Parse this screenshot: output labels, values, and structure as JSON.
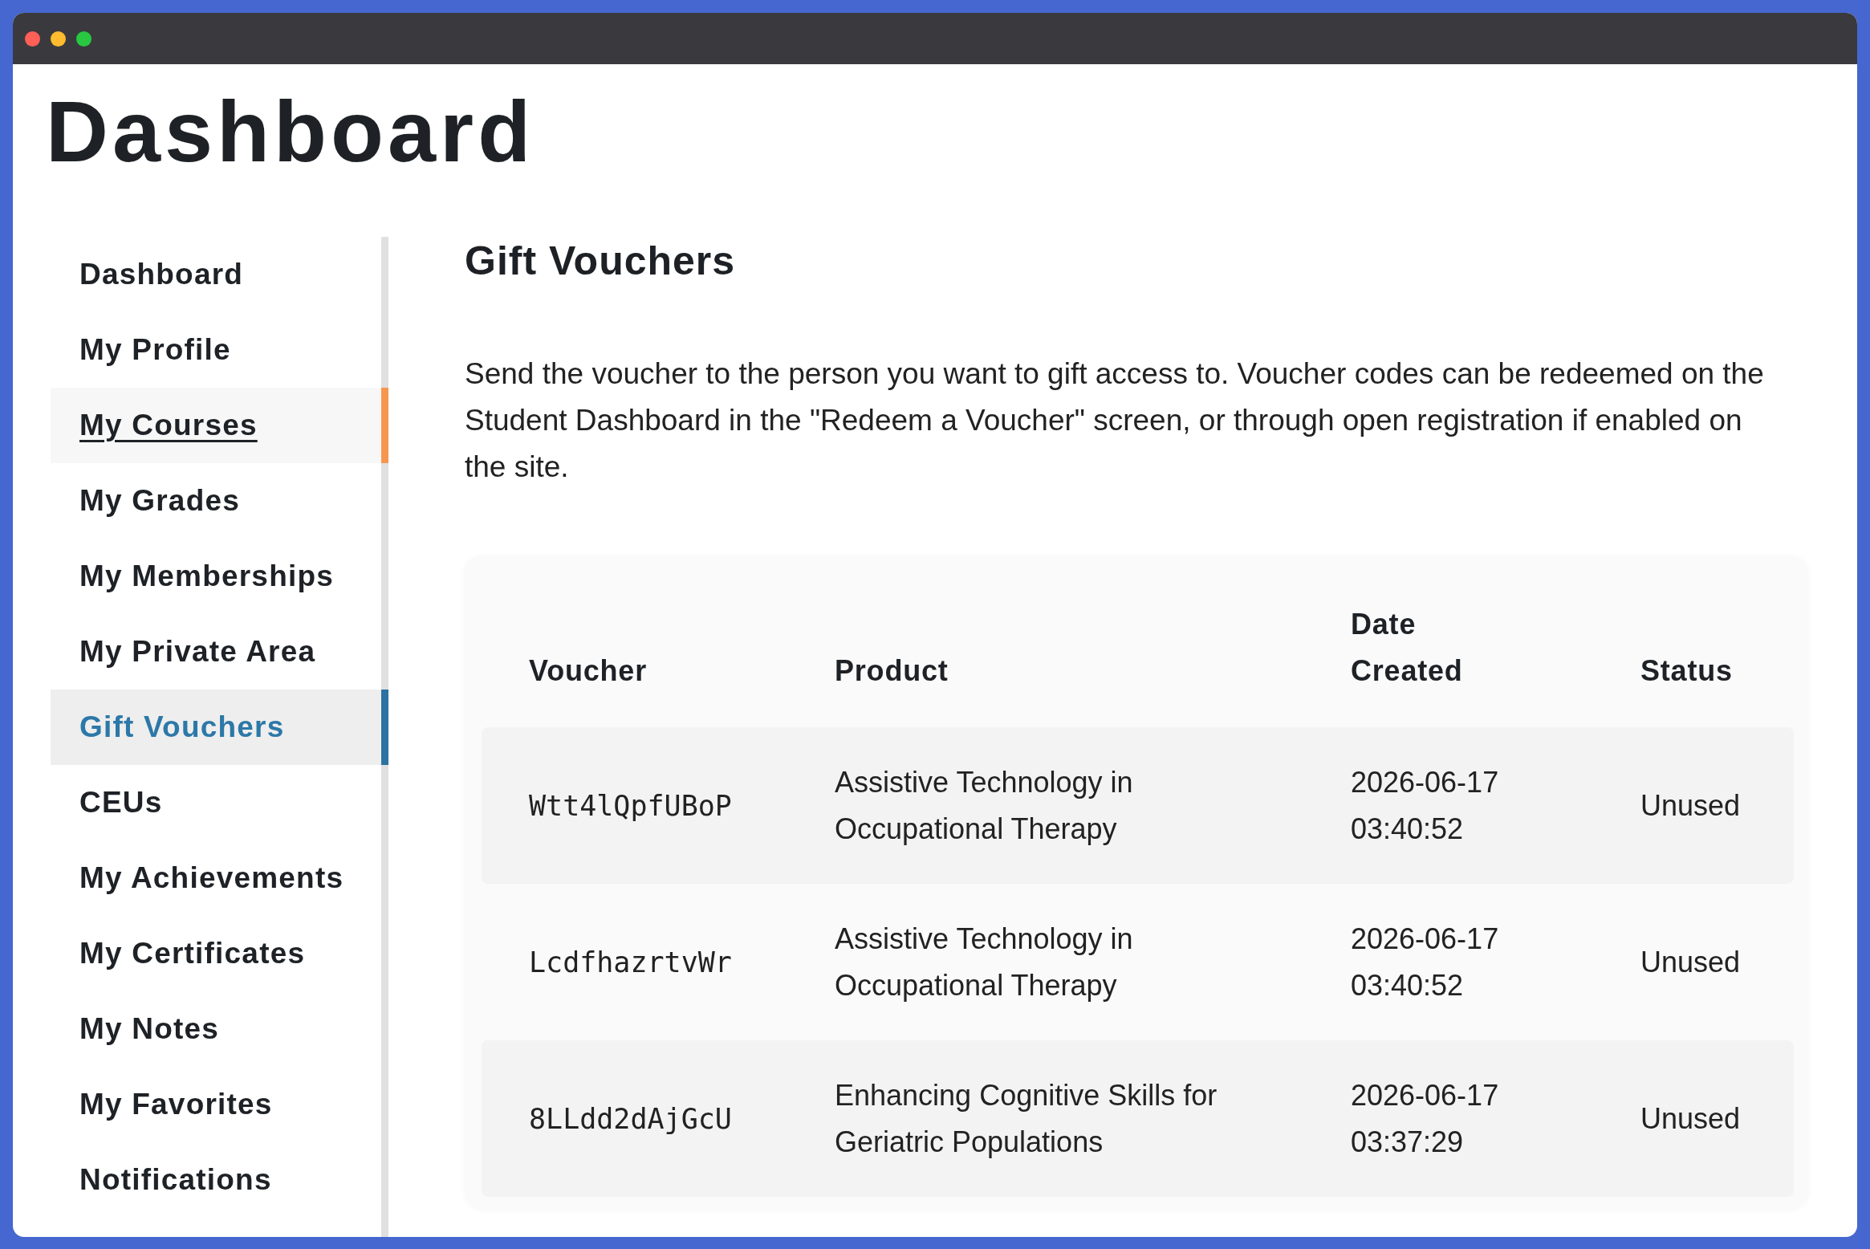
{
  "page_title": "Dashboard",
  "sidebar": {
    "items": [
      {
        "label": "Dashboard",
        "selected": false,
        "hovered": false
      },
      {
        "label": "My Profile",
        "selected": false,
        "hovered": false
      },
      {
        "label": "My Courses",
        "selected": false,
        "hovered": true
      },
      {
        "label": "My Grades",
        "selected": false,
        "hovered": false
      },
      {
        "label": "My Memberships",
        "selected": false,
        "hovered": false
      },
      {
        "label": "My Private Area",
        "selected": false,
        "hovered": false
      },
      {
        "label": "Gift Vouchers",
        "selected": true,
        "hovered": false
      },
      {
        "label": "CEUs",
        "selected": false,
        "hovered": false
      },
      {
        "label": "My Achievements",
        "selected": false,
        "hovered": false
      },
      {
        "label": "My Certificates",
        "selected": false,
        "hovered": false
      },
      {
        "label": "My Notes",
        "selected": false,
        "hovered": false
      },
      {
        "label": "My Favorites",
        "selected": false,
        "hovered": false
      },
      {
        "label": "Notifications",
        "selected": false,
        "hovered": false
      }
    ]
  },
  "content": {
    "heading": "Gift Vouchers",
    "description": "Send the voucher to the person you want to gift access to. Voucher codes can be redeemed on the Student Dashboard in the \"Redeem a Voucher\" screen, or through open registration if enabled on the site.",
    "table": {
      "columns": [
        "Voucher",
        "Product",
        "Date Created",
        "Status"
      ],
      "rows": [
        {
          "voucher": "Wtt4lQpfUBoP",
          "product": "Assistive Technology in Occupational Therapy",
          "date_created": "2026-06-17 03:40:52",
          "status": "Unused"
        },
        {
          "voucher": "LcdfhazrtvWr",
          "product": "Assistive Technology in Occupational Therapy",
          "date_created": "2026-06-17 03:40:52",
          "status": "Unused"
        },
        {
          "voucher": "8LLdd2dAjGcU",
          "product": "Enhancing Cognitive Skills for Geriatric Populations",
          "date_created": "2026-06-17 03:37:29",
          "status": "Unused"
        }
      ]
    }
  }
}
